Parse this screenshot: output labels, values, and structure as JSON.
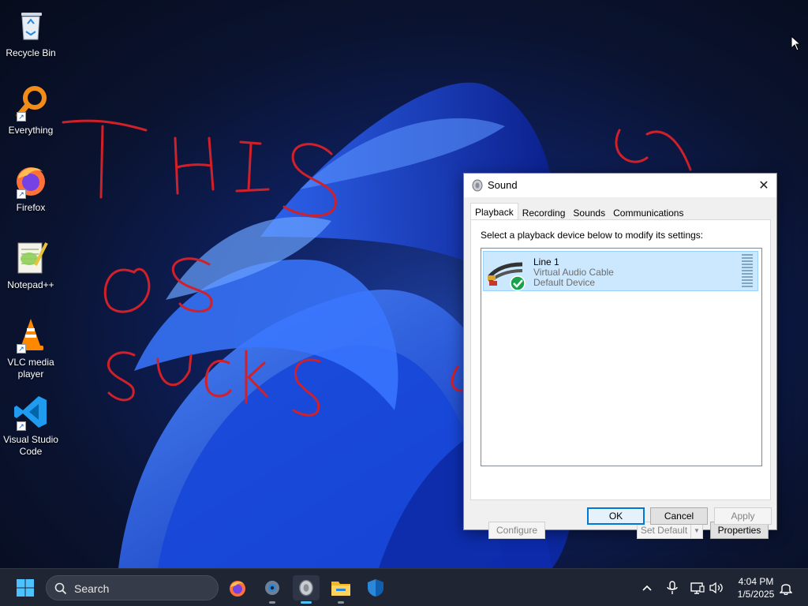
{
  "desktop": {
    "icons": [
      {
        "label": "Recycle Bin",
        "icon": "recycle-bin-icon"
      },
      {
        "label": "Everything",
        "icon": "everything-search-icon"
      },
      {
        "label": "Firefox",
        "icon": "firefox-icon"
      },
      {
        "label": "Notepad++",
        "icon": "notepad-plus-plus-icon"
      },
      {
        "label": "VLC media player",
        "icon": "vlc-icon"
      },
      {
        "label": "Visual Studio Code",
        "icon": "vscode-icon"
      }
    ]
  },
  "dialog": {
    "title": "Sound",
    "tabs": [
      "Playback",
      "Recording",
      "Sounds",
      "Communications"
    ],
    "active_tab": "Playback",
    "instruction": "Select a playback device below to modify its settings:",
    "devices": [
      {
        "name": "Line 1",
        "description": "Virtual Audio Cable",
        "status": "Default Device",
        "icon": "audio-cable-icon"
      }
    ],
    "buttons": {
      "configure": "Configure",
      "set_default": "Set Default",
      "properties": "Properties",
      "ok": "OK",
      "cancel": "Cancel",
      "apply": "Apply"
    }
  },
  "taskbar": {
    "search_placeholder": "Search",
    "time": "4:04 PM",
    "date": "1/5/2025"
  },
  "colors": {
    "accent": "#0078d7",
    "selection": "#cce8ff",
    "taskbar": "#1f2533",
    "scribble": "#d0202a"
  }
}
